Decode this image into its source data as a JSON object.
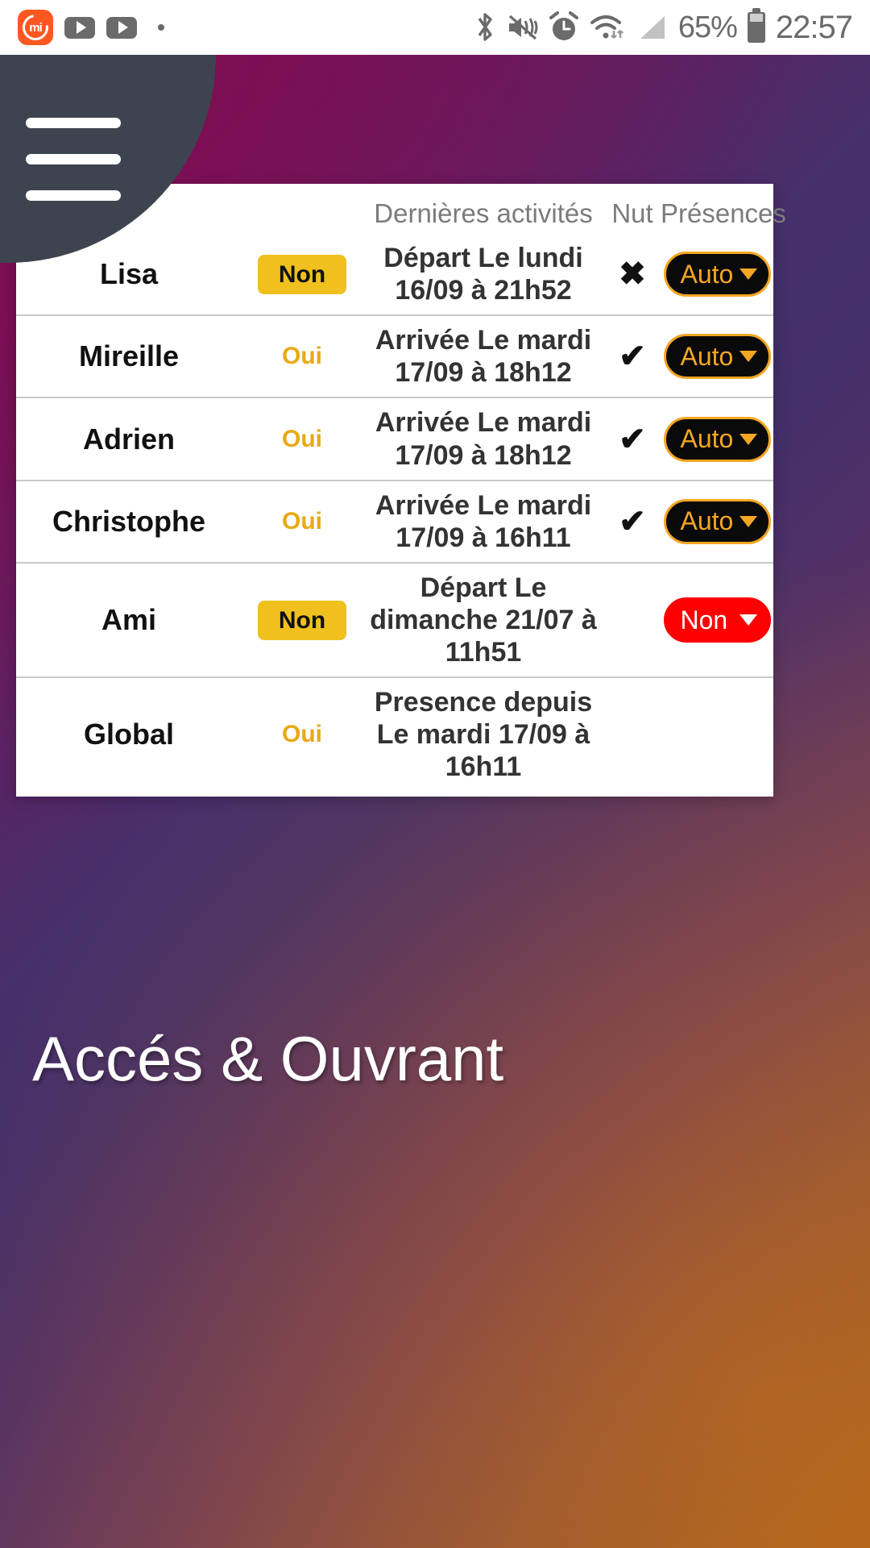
{
  "status_bar": {
    "left_icons": [
      "mi-app-icon",
      "youtube-icon",
      "youtube-icon",
      "dot-icon"
    ],
    "mi_label": "mi",
    "right_icons": [
      "bluetooth-icon",
      "vibrate-mute-icon",
      "alarm-icon",
      "wifi-icon",
      "cellular-signal-icon"
    ],
    "battery_percent": "65%",
    "clock": "22:57"
  },
  "menu": {
    "name": "hamburger-menu",
    "lines": 3
  },
  "table": {
    "headers": {
      "name": "",
      "nutri": "",
      "activities": "Dernières activités",
      "nut": "Nut",
      "presences": "Présences"
    },
    "rows": [
      {
        "name": "Lisa",
        "nutri": "Non",
        "nutri_badge": true,
        "activity": "Départ Le lundi 16/09 à 21h52",
        "nut": "✖",
        "presence": "Auto",
        "presence_style": "auto"
      },
      {
        "name": "Mireille",
        "nutri": "Oui",
        "nutri_badge": false,
        "activity": "Arrivée Le mardi 17/09 à 18h12",
        "nut": "✔",
        "presence": "Auto",
        "presence_style": "auto"
      },
      {
        "name": "Adrien",
        "nutri": "Oui",
        "nutri_badge": false,
        "activity": "Arrivée Le mardi 17/09 à 18h12",
        "nut": "✔",
        "presence": "Auto",
        "presence_style": "auto"
      },
      {
        "name": "Christophe",
        "nutri": "Oui",
        "nutri_badge": false,
        "activity": "Arrivée Le mardi 17/09 à 16h11",
        "nut": "✔",
        "presence": "Auto",
        "presence_style": "auto"
      },
      {
        "name": "Ami",
        "nutri": "Non",
        "nutri_badge": true,
        "activity": "Départ Le dimanche 21/07 à 11h51",
        "nut": "",
        "presence": "Non",
        "presence_style": "non"
      },
      {
        "name": "Global",
        "nutri": "Oui",
        "nutri_badge": false,
        "activity": "Presence depuis Le mardi 17/09 à 16h11",
        "nut": "",
        "presence": "",
        "presence_style": "none"
      }
    ]
  },
  "page": {
    "title": "Accés & Ouvrant"
  },
  "colors": {
    "accent_orange": "#F5A623",
    "badge_yellow": "#F0C01E",
    "status_red": "#FF0000",
    "menu_dark": "#3e444f",
    "bg_purple": "#6d0f4a",
    "bg_orange": "#a7631f"
  }
}
